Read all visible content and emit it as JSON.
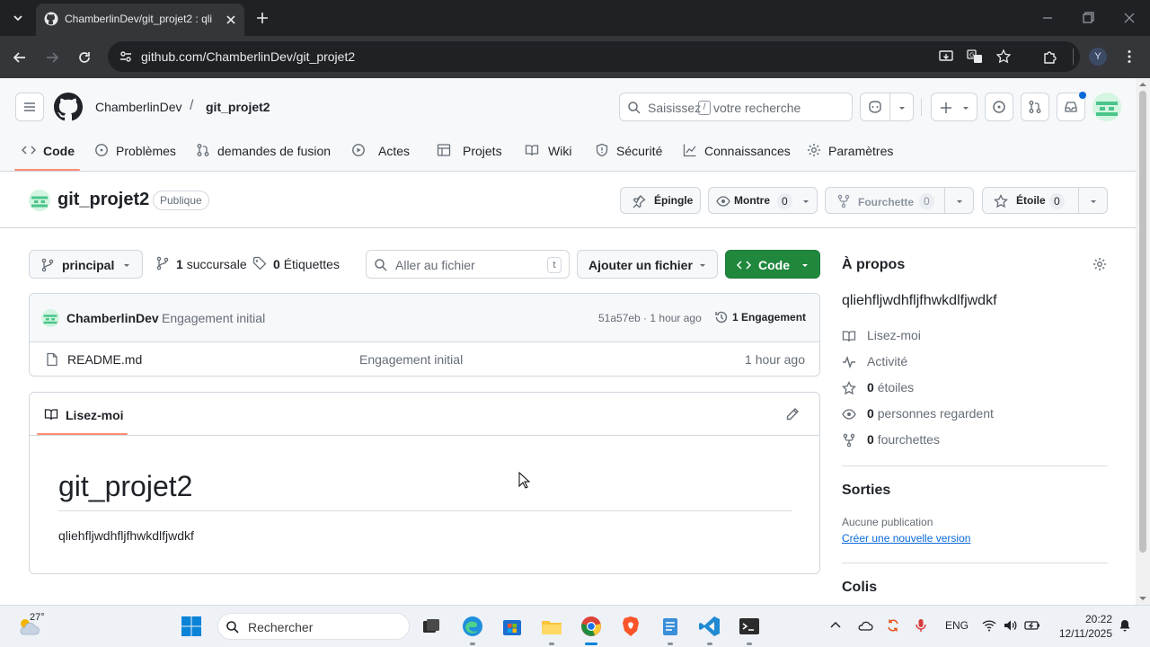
{
  "browser": {
    "tab_title": "ChamberlinDev/git_projet2 : qli",
    "url": "github.com/ChamberlinDev/git_projet2",
    "profile_initial": "Y"
  },
  "header": {
    "owner": "ChamberlinDev",
    "separator": "/",
    "repo": "git_projet2",
    "search_placeholder_1": "Saisissez",
    "search_key": "/",
    "search_placeholder_2": "votre recherche"
  },
  "repo_nav": [
    {
      "label": "Code",
      "icon": "code-icon"
    },
    {
      "label": "Problèmes",
      "icon": "issue-icon"
    },
    {
      "label": "demandes de fusion",
      "icon": "pull-request-icon"
    },
    {
      "label": "Actes",
      "icon": "play-icon"
    },
    {
      "label": "Projets",
      "icon": "table-icon"
    },
    {
      "label": "Wiki",
      "icon": "book-icon"
    },
    {
      "label": "Sécurité",
      "icon": "shield-icon"
    },
    {
      "label": "Connaissances",
      "icon": "graph-icon"
    },
    {
      "label": "Paramètres",
      "icon": "gear-icon"
    }
  ],
  "repo": {
    "name": "git_projet2",
    "visibility": "Publique",
    "pin_label": "Épingle",
    "watch_label": "Montre",
    "watch_count": "0",
    "fork_label": "Fourchette",
    "fork_count": "0",
    "star_label": "Étoile",
    "star_count": "0"
  },
  "filenav": {
    "branch": "principal",
    "branches_count": "1",
    "branches_label": "succursale",
    "tags_count": "0",
    "tags_label": "Étiquettes",
    "goto_placeholder": "Aller au fichier",
    "goto_key": "t",
    "add_file": "Ajouter un fichier",
    "code_button": "Code"
  },
  "commit": {
    "author": "ChamberlinDev",
    "message": "Engagement initial",
    "sha_time": "51a57eb · 1 hour ago",
    "history": "1 Engagement"
  },
  "files": [
    {
      "name": "README.md",
      "message": "Engagement initial",
      "time": "1 hour ago"
    }
  ],
  "readme": {
    "tab_label": "Lisez-moi",
    "heading": "git_projet2",
    "body": "qliehfljwdhfljfhwkdlfjwdkf"
  },
  "sidebar": {
    "about_title": "À propos",
    "description": "qliehfljwdhfljfhwkdlfjwdkf",
    "readme_link": "Lisez-moi",
    "activity_link": "Activité",
    "stars_count": "0",
    "stars_label": "étoiles",
    "watchers_count": "0",
    "watchers_label": "personnes regardent",
    "forks_count": "0",
    "forks_label": "fourchettes",
    "releases_title": "Sorties",
    "no_release": "Aucune publication",
    "create_release": "Créer une nouvelle version",
    "packages_title": "Colis"
  },
  "taskbar": {
    "temperature": "27°",
    "search_label": "Rechercher",
    "language": "ENG",
    "time": "20:22",
    "date": "12/11/2025"
  },
  "colors": {
    "primary_button": "#1f883d",
    "accent_underline": "#fd8c73",
    "link": "#0969da"
  }
}
